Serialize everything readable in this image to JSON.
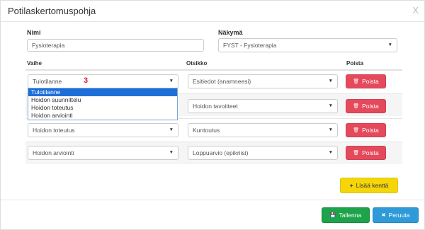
{
  "modal": {
    "title": "Potilaskertomuspohja",
    "close_label": "X"
  },
  "form": {
    "name_label": "Nimi",
    "name_value": "Fysioterapia",
    "view_label": "Näkymä",
    "view_value": "FYST - Fysioterapia"
  },
  "table": {
    "headers": {
      "phase": "Vaihe",
      "title": "Otsikko",
      "delete": "Poista"
    },
    "rows": [
      {
        "phase": "Tulotilanne",
        "title": "Esitiedot (anamneesi)",
        "delete": "Poista"
      },
      {
        "phase": "Hoidon suunnittelu",
        "title": "Hoidon tavoitteet",
        "delete": "Poista"
      },
      {
        "phase": "Hoidon toteutus",
        "title": "Kuntoutus",
        "delete": "Poista"
      },
      {
        "phase": "Hoidon arviointi",
        "title": "Loppuarvio (epikriisi)",
        "delete": "Poista"
      }
    ]
  },
  "dropdown": {
    "options": [
      "Tulotilanne",
      "Hoidon suunnittelu",
      "Hoidon toteutus",
      "Hoidon arviointi"
    ],
    "selected_index": 0
  },
  "annotation": "3",
  "buttons": {
    "add_field": "Lisää kenttä",
    "save": "Tallenna",
    "cancel": "Peruuta"
  },
  "icons": {
    "caret": "▼",
    "trash": "🗑",
    "plus": "+",
    "save": "💾",
    "cancel": "✖"
  }
}
